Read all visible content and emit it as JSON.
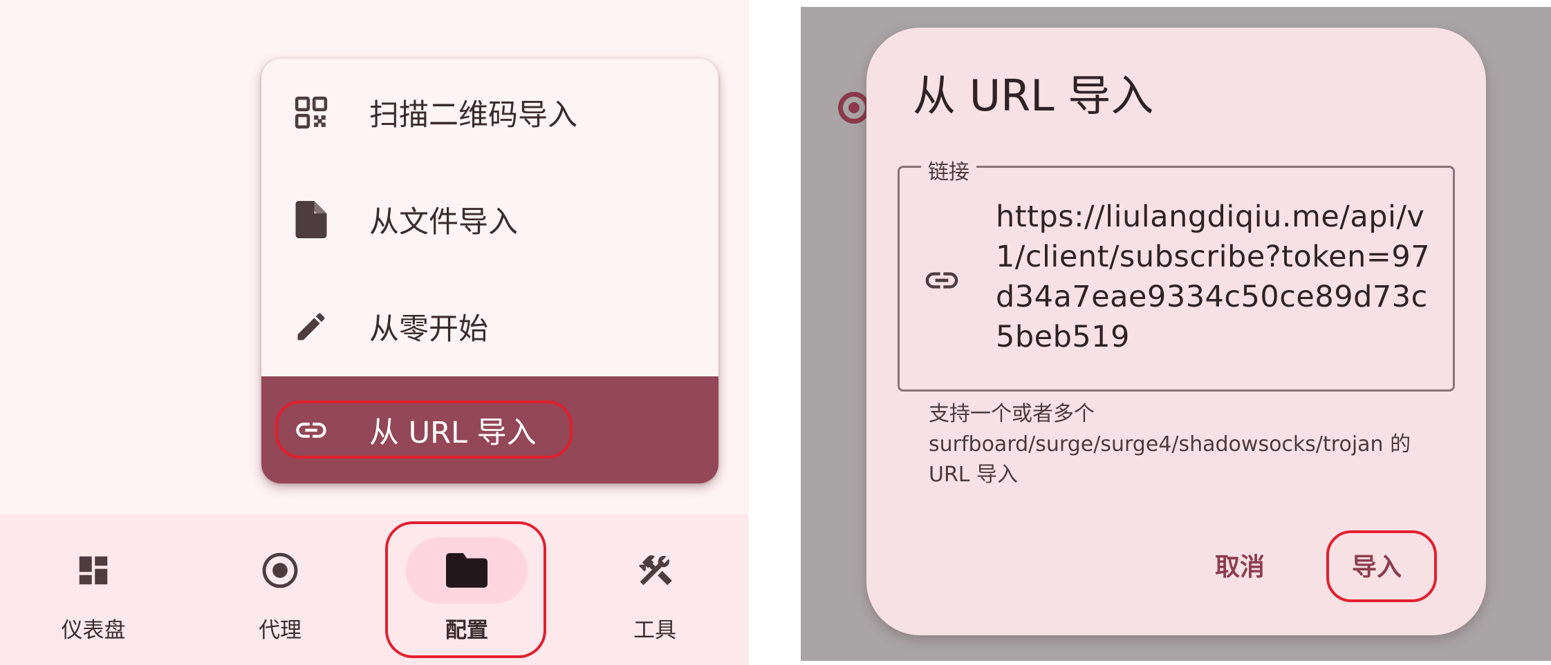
{
  "menu": {
    "items": [
      {
        "label": "扫描二维码导入",
        "icon": "qr-code-icon"
      },
      {
        "label": "从文件导入",
        "icon": "file-icon"
      },
      {
        "label": "从零开始",
        "icon": "pencil-icon"
      },
      {
        "label": "从 URL 导入",
        "icon": "link-icon",
        "selected": true
      }
    ]
  },
  "bottom_nav": {
    "items": [
      {
        "label": "仪表盘",
        "icon": "dashboard-icon"
      },
      {
        "label": "代理",
        "icon": "radio-target-icon"
      },
      {
        "label": "配置",
        "icon": "folder-icon",
        "active": true
      },
      {
        "label": "工具",
        "icon": "tools-icon"
      }
    ]
  },
  "dialog": {
    "title": "从 URL 导入",
    "field_label": "链接",
    "field_value": "https://liulangdiqiu.me/api/v1/client/subscribe?token=97d34a7eae9334c50ce89d73c5beb519",
    "helper_text": "支持一个或者多个 surfboard/surge/surge4/shadowsocks/trojan 的 URL 导入",
    "cancel_label": "取消",
    "import_label": "导入"
  },
  "colors": {
    "accent": "#944756",
    "highlight": "#e0202e",
    "nav_bg": "#fde8ec",
    "dialog_bg": "#f8e1e4",
    "scrim": "#a9a5a6"
  }
}
